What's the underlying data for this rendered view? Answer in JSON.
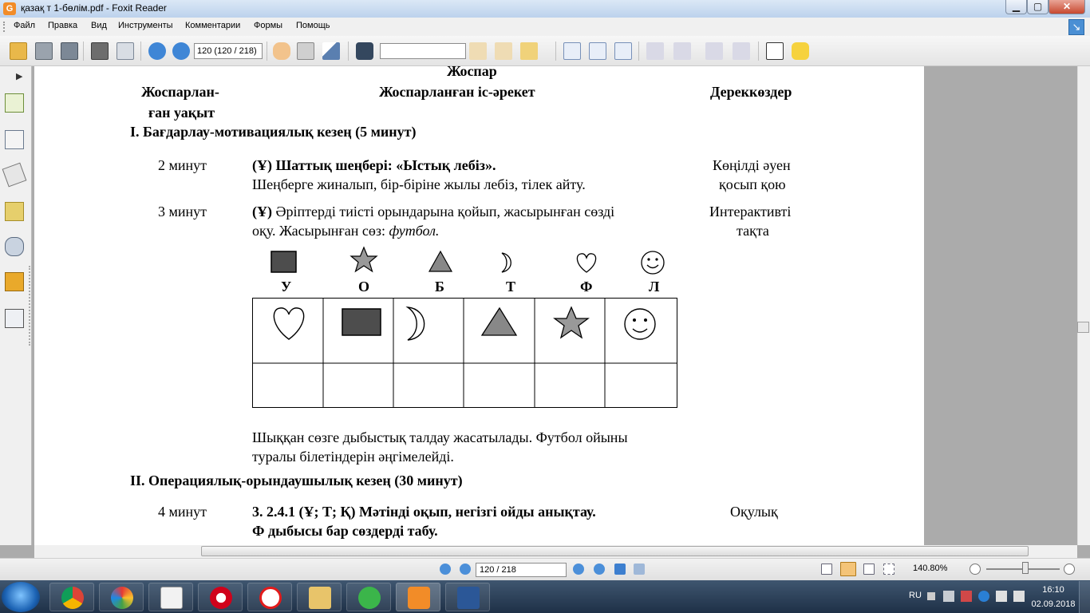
{
  "window": {
    "title": "қазақ т 1-бөлім.pdf - Foxit Reader",
    "app_icon": "foxit-icon",
    "controls": [
      "minimize-icon",
      "maximize-icon",
      "close-icon"
    ],
    "min_glyph": "▁",
    "max_glyph": "▢",
    "close_glyph": "✕",
    "icon_letter": "G"
  },
  "menu": {
    "items": [
      "Файл",
      "Правка",
      "Вид",
      "Инструменты",
      "Комментарии",
      "Формы",
      "Помощь"
    ],
    "help_glyph": "↘"
  },
  "toolbar": {
    "page_field": "120 (120 / 218)",
    "find_field": "",
    "icons": [
      "open-icon",
      "save-icon",
      "save-as-icon",
      "print-icon",
      "properties-icon",
      "prev-page-icon",
      "next-page-icon",
      "hand-icon",
      "select-text-icon",
      "select-arrow-icon",
      "find-icon",
      "find-prev-icon",
      "find-next-icon",
      "highlight-icon",
      "zoom-100-icon",
      "fit-page-icon",
      "fit-width-icon",
      "pdf-create-icon",
      "pdf-export-icon",
      "pdf-convert-icon",
      "pdf-edit-icon",
      "typewriter-icon",
      "note-icon"
    ]
  },
  "left_panel": {
    "toggle": "▶",
    "icons": [
      "bookmarks-icon",
      "pages-icon",
      "layers-icon",
      "comments-icon",
      "attachments-icon",
      "security-icon",
      "signature-icon"
    ]
  },
  "document": {
    "heading": "Жоспар",
    "col_time_1": "Жоспарлан-",
    "col_time_2": "ған уақыт",
    "col_action": "Жоспарланған іс-әрекет",
    "col_resources": "Дереккөздер",
    "section1": "I. Бағдарлау-мотивациялық кезең (5 минут)",
    "row1_time": "2 минут",
    "row1_title": "(Ұ) Шаттық шеңбері: «Ыстық лебіз».",
    "row1_text": "Шеңберге жиналып, бір-біріне жылы лебіз, тілек айту.",
    "row1_res_1": "Көңілді әуен",
    "row1_res_2": "қосып қою",
    "row2_time": "3 минут",
    "row2_prefix": "(Ұ)",
    "row2_text_1": " Әріптерді тиісті орындарына қойып, жасырынған сөзді",
    "row2_text_2": "оқу.  Жасырынған сөз: ",
    "row2_word": "футбол.",
    "row2_res_1": "Интерактивті",
    "row2_res_2": "тақта",
    "legend_shapes": [
      "square",
      "star",
      "triangle",
      "moon",
      "heart",
      "smiley"
    ],
    "legend_letters": [
      "У",
      "О",
      "Б",
      "Т",
      "Ф",
      "Л"
    ],
    "grid_shapes": [
      "heart",
      "square",
      "moon",
      "triangle",
      "star",
      "smiley"
    ],
    "after_1": "Шыққан сөзге дыбыстық талдау жасатылады. Футбол ойыны",
    "after_2": "туралы білетіндерін әңгімелейді.",
    "section2": "II. Операциялық-орындаушылық кезең (30 минут)",
    "row3_time": "4 минут",
    "row3_title_1": "3. 2.4.1 (Ұ; Т; Қ) Мәтінді оқып, негізгі ойды анықтау.",
    "row3_title_2": "Ф дыбысы бар сөздерді табу.",
    "row3_res": "Оқулық"
  },
  "status": {
    "page_field": "120 / 218",
    "zoom": "140.80%",
    "zoom_level_percent": 52
  },
  "taskbar": {
    "apps": [
      "chrome-icon",
      "paint-icon",
      "calculator-icon",
      "opera-icon",
      "yandex-icon",
      "explorer-icon",
      "mail-agent-icon",
      "foxit-pdf-icon",
      "word-icon"
    ],
    "lang": "RU",
    "time": "16:10",
    "date": "02.09.2018"
  }
}
